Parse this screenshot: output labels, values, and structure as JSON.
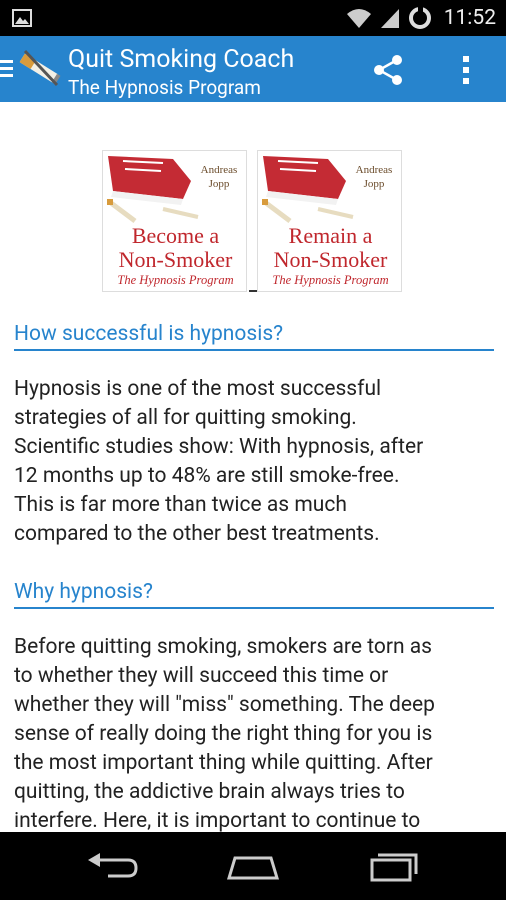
{
  "status_bar": {
    "time": "11:52",
    "icons": [
      "image-icon",
      "wifi-icon",
      "signal-icon",
      "sync-icon"
    ]
  },
  "action_bar": {
    "title": "Quit Smoking Coach",
    "subtitle": "The Hypnosis Program",
    "background_color": "#2784cd",
    "icons": [
      "menu-icon",
      "app-logo",
      "share-icon",
      "overflow-menu-icon"
    ]
  },
  "covers": [
    {
      "author_first": "Andreas",
      "author_last": "Jopp",
      "line1": "Become a",
      "line2": "Non-Smoker",
      "line3": "The Hypnosis Program"
    },
    {
      "author_first": "Andreas",
      "author_last": "Jopp",
      "line1": "Remain a",
      "line2": "Non-Smoker",
      "line3": "The Hypnosis Program"
    }
  ],
  "sections": [
    {
      "heading": "How successful is hypnosis?",
      "lines": [
        "Hypnosis is one of the most successful",
        "strategies of all for quitting smoking.",
        "Scientific studies show: With hypnosis, after",
        "12 months up to 48% are still smoke-free.",
        "This is far more than twice as much",
        "compared to the other best treatments."
      ]
    },
    {
      "heading": "Why hypnosis?",
      "lines": [
        "Before quitting smoking, smokers are torn as",
        "to whether they will succeed this time or",
        "whether they will \"miss\" something. The deep",
        "sense of really doing the right thing for you is",
        "the most important thing while quitting. After",
        "quitting, the addictive brain always tries to",
        "interfere. Here, it is important to continue to"
      ]
    }
  ],
  "nav_bar": {
    "buttons": [
      "back-icon",
      "home-icon",
      "recent-apps-icon"
    ]
  }
}
